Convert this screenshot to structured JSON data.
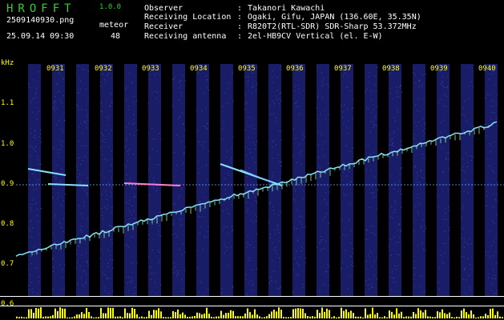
{
  "app": {
    "name": "HROFFT",
    "version": "1.0.0"
  },
  "file": {
    "name": "2509140930.png",
    "datetime": "25.09.14 09:30"
  },
  "meteor": {
    "label": "meteor",
    "count": "48"
  },
  "info": [
    {
      "label": "Observer",
      "sep": ":",
      "value": "Takanori Kawachi"
    },
    {
      "label": "Receiving Location",
      "sep": ":",
      "value": "Ogaki, Gifu, JAPAN (136.60E, 35.35N)"
    },
    {
      "label": "Receiver",
      "sep": ":",
      "value": "R820T2(RTL-SDR) SDR-Sharp 53.372MHz"
    },
    {
      "label": "Receiving antenna",
      "sep": ":",
      "value": "2el-HB9CV Vertical (el. E-W)"
    }
  ],
  "axis": {
    "unit": "kHz",
    "y_ticks": [
      "1.1",
      "1.0",
      "0.9",
      "0.8",
      "0.7",
      "0.6"
    ],
    "x_ticks": [
      "0931",
      "0932",
      "0933",
      "0934",
      "0935",
      "0936",
      "0937",
      "0938",
      "0939",
      "0940"
    ]
  },
  "colors": {
    "background": "#000000",
    "brand": "#33cc33",
    "accent": "#ffff00",
    "spectrum_band": "#1a1f6e",
    "trace": "#88e0ff",
    "power_bars": "#ffff00"
  }
}
